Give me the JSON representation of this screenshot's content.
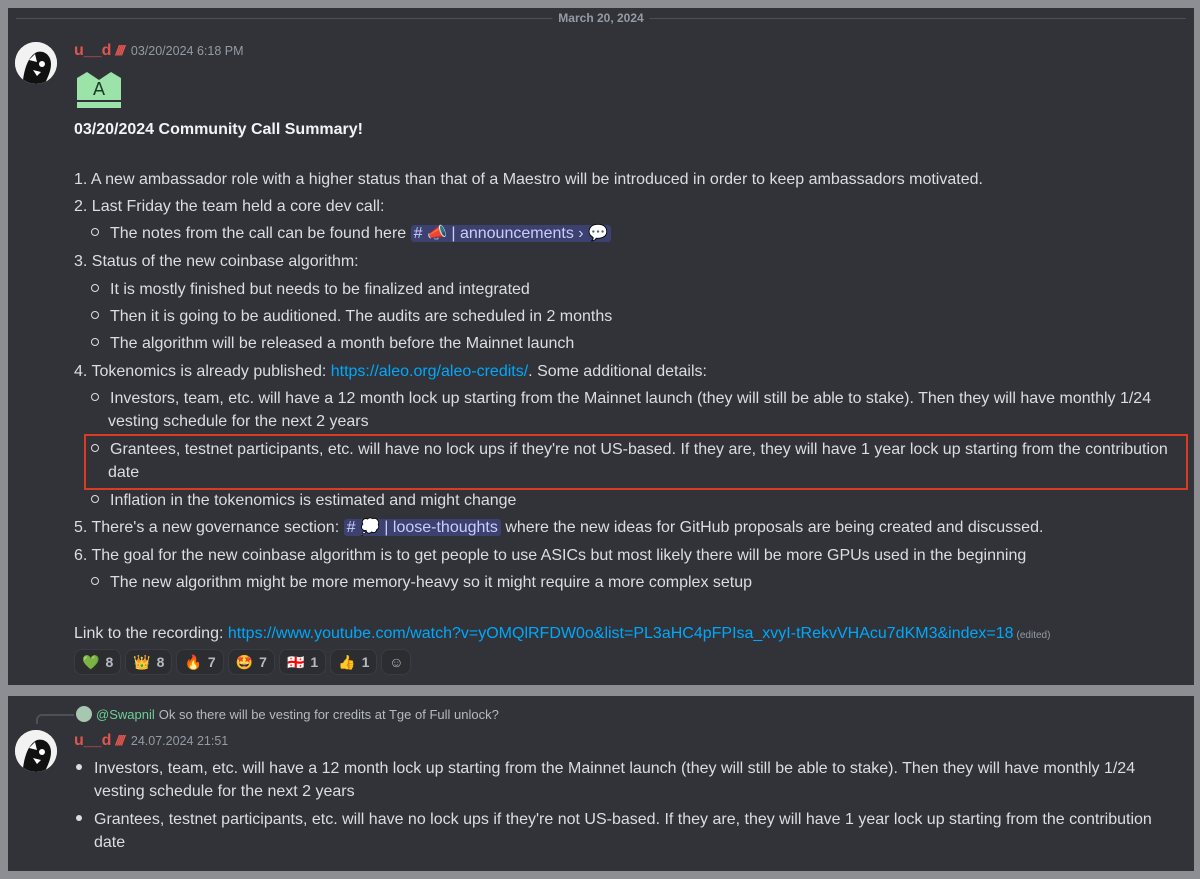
{
  "date_divider": "March 20, 2024",
  "message1": {
    "author": "u__d",
    "role_icon": "////",
    "timestamp": "03/20/2024 6:18 PM",
    "title": "03/20/2024 Community Call Summary!",
    "items": {
      "i1": "1. A new ambassador role with a higher status than that of a Maestro will be introduced in order to keep ambassadors motivated.",
      "i2": "2. Last Friday the team held a core dev call:",
      "i2a": "The notes from the call can be found here",
      "i2a_channel": "📣 | announcements",
      "i3": "3. Status of the new coinbase algorithm:",
      "i3a": "It is mostly finished but needs to be finalized and integrated",
      "i3b": "Then it is going to be auditioned. The audits are scheduled in 2 months",
      "i3c": "The algorithm will be released a month before the Mainnet launch",
      "i4_prefix": "4. Tokenomics is already published: ",
      "i4_link": "https://aleo.org/aleo-credits/",
      "i4_suffix": ". Some additional details:",
      "i4a_line1": "Investors, team, etc. will have a 12 month lock up starting from the Mainnet launch (they will still be able to stake). Then they will have monthly 1/24",
      "i4a_line2": "vesting schedule for the next 2 years",
      "i4b_line1": "Grantees, testnet participants, etc. will have no lock ups if they're not US-based. If they are, they will have 1 year lock up starting from the contribution",
      "i4b_line2": "date",
      "i4c": "Inflation in the tokenomics is estimated and might change",
      "i5_prefix": "5. There's a new governance section: ",
      "i5_channel": "💭 | loose-thoughts",
      "i5_suffix": " where the new ideas for GitHub proposals are being created and discussed.",
      "i6": "6. The goal for the new coinbase algorithm is to get people to use ASICs but most likely there will be more GPUs used in the beginning",
      "i6a": "The new algorithm might be more memory-heavy so it might require a more complex setup"
    },
    "recording_prefix": "Link to the recording: ",
    "recording_link": "https://www.youtube.com/watch?v=yOMQlRFDW0o&list=PL3aHC4pFPIsa_xvyI-tRekvVHAcu7dKM3&index=18",
    "edited": "(edited)",
    "reactions": [
      {
        "emoji": "💚",
        "count": "8"
      },
      {
        "emoji": "👑",
        "count": "8"
      },
      {
        "emoji": "🔥",
        "count": "7"
      },
      {
        "emoji": "🤩",
        "count": "7"
      },
      {
        "emoji": "🇬🇪",
        "count": "1"
      },
      {
        "emoji": "👍",
        "count": "1"
      }
    ],
    "add_reaction": "☺"
  },
  "message2": {
    "reply_author": "@Swapnil",
    "reply_text": "Ok so there will be vesting for credits at Tge of Full unlock?",
    "author": "u__d",
    "role_icon": "////",
    "timestamp": "24.07.2024 21:51",
    "b1_line1": "Investors, team, etc. will have a 12 month lock up starting from the Mainnet launch (they will still be able to stake). Then they will have monthly 1/24",
    "b1_line2": "vesting schedule for the next 2 years",
    "b2_line1": "Grantees, testnet participants, etc. will have no lock ups if they're not US-based. If they are, they will have 1 year lock up starting from the contribution",
    "b2_line2": "date"
  },
  "colors": {
    "username": "#e0554f",
    "link": "#00a8fc",
    "highlight_border": "#d93b23",
    "background": "#313338"
  }
}
